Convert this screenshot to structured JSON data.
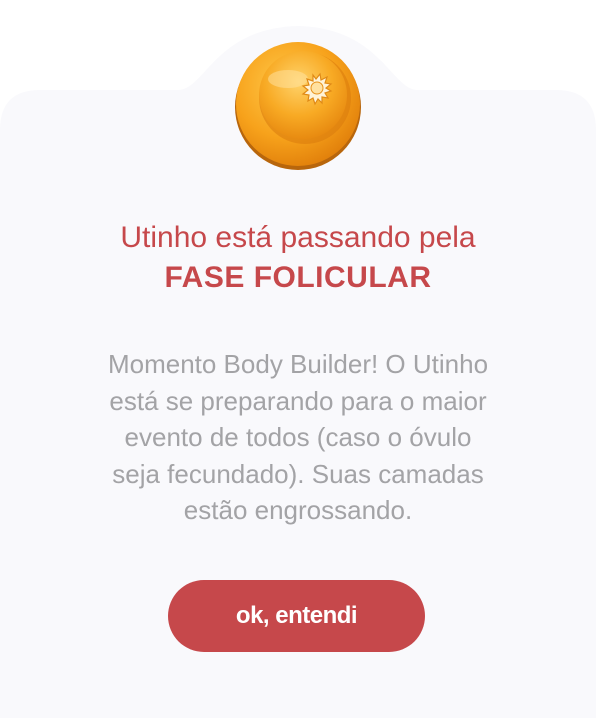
{
  "dialog": {
    "title_line1": "Utinho está passando pela",
    "title_line2": "FASE FOLICULAR",
    "message_lines": [
      "Momento Body Builder! O Utinho",
      "está se preparando para o maior",
      "evento de todos (caso o óvulo",
      "seja fecundado). Suas camadas",
      "estão engrossando."
    ],
    "confirm_label": "ok, entendi",
    "icon": "orange-follicle-icon"
  },
  "colors": {
    "accent": "#c6484b",
    "card_background": "#f9f9fc",
    "message_text": "#a3a3a6",
    "icon_orange": "#f7a21b"
  }
}
